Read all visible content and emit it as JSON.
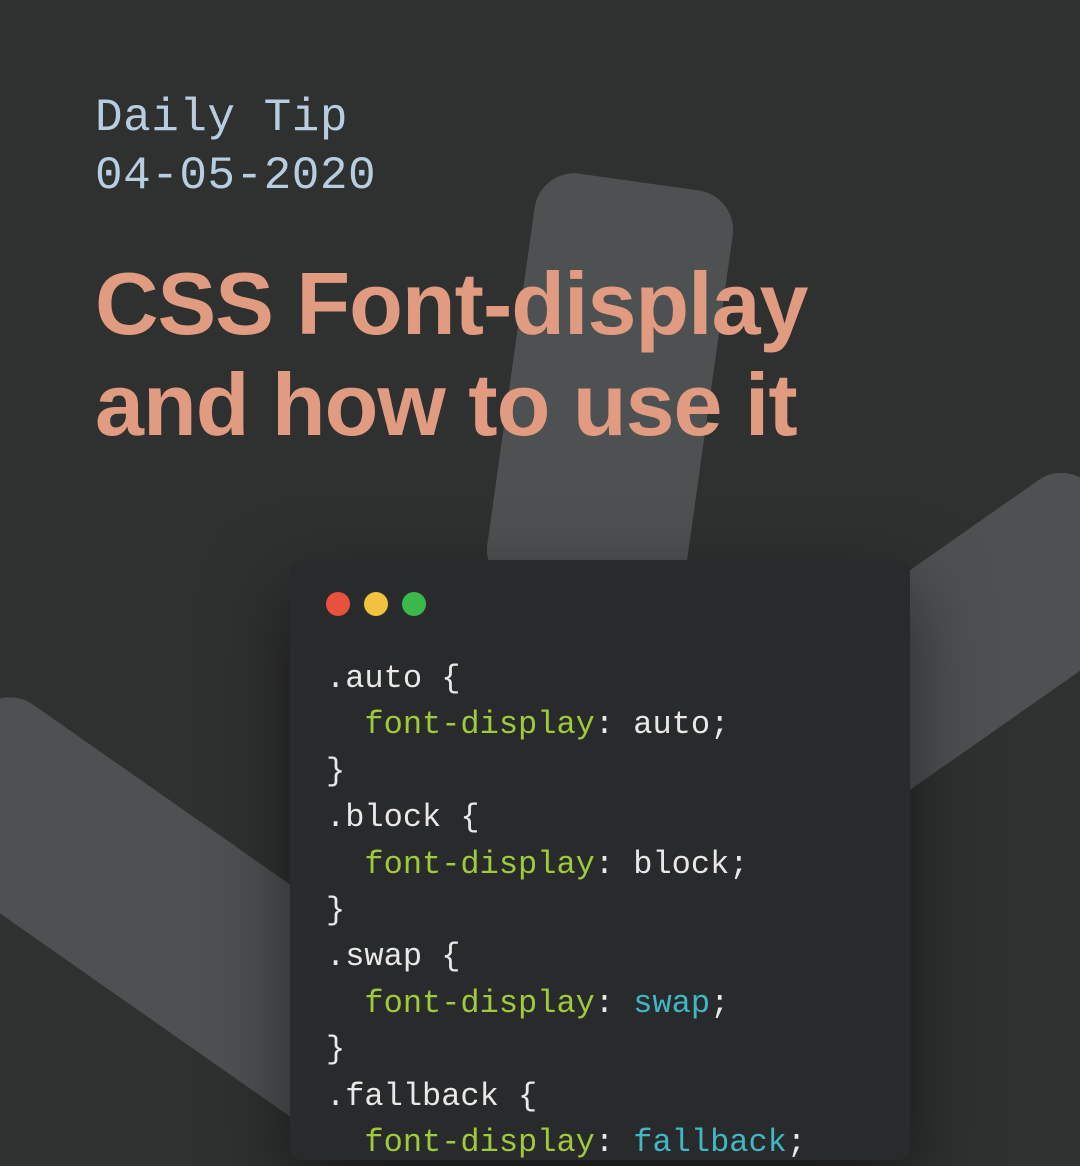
{
  "header": {
    "subtitle_line1": "Daily Tip",
    "subtitle_line2": "04-05-2020",
    "title_line1": "CSS Font-display",
    "title_line2": "and how to use it"
  },
  "colors": {
    "accent": "#e19b81",
    "subtitle": "#b8cde0",
    "bg": "#2f3030",
    "window": "#282a2b",
    "prop": "#9fca3a",
    "keyword": "#3fb7c4"
  },
  "code": {
    "rules": [
      {
        "selector": ".auto",
        "prop": "font-display",
        "value": "auto",
        "value_kw": false
      },
      {
        "selector": ".block",
        "prop": "font-display",
        "value": "block",
        "value_kw": false
      },
      {
        "selector": ".swap",
        "prop": "font-display",
        "value": "swap",
        "value_kw": true
      },
      {
        "selector": ".fallback",
        "prop": "font-display",
        "value": "fallback",
        "value_kw": true
      }
    ]
  }
}
